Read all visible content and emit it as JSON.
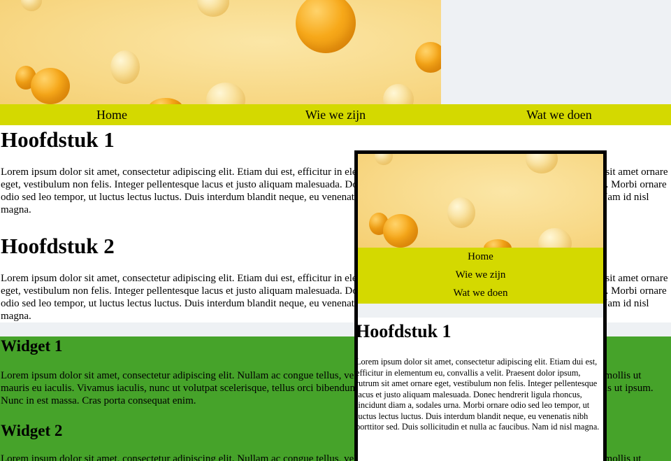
{
  "nav": {
    "items": [
      "Home",
      "Wie we zijn",
      "Wat we doen"
    ]
  },
  "main": {
    "sections": [
      {
        "title": "Hoofdstuk 1",
        "text": "Lorem ipsum dolor sit amet, consectetur adipiscing elit. Etiam dui est, efficitur in elementum eu, convallis a velit. Praesent dolor ipsum, rutrum sit amet ornare eget, vestibulum non felis. Integer pellentesque lacus et justo aliquam malesuada. Donec hendrerit ligula rhoncus, tincidunt diam a, sodales urna. Morbi ornare odio sed leo tempor, ut luctus lectus luctus. Duis interdum blandit neque, eu venenatis nibh porttitor sed. Duis sollicitudin et nulla ac faucibus. Nam id nisl magna."
      },
      {
        "title": "Hoofdstuk 2",
        "text": "Lorem ipsum dolor sit amet, consectetur adipiscing elit. Etiam dui est, efficitur in elementum eu, convallis a velit. Praesent dolor ipsum, rutrum sit amet ornare eget, vestibulum non felis. Integer pellentesque lacus et justo aliquam malesuada. Donec hendrerit ligula rhoncus, tincidunt diam a, sodales urna. Morbi ornare odio sed leo tempor, ut luctus lectus luctus. Duis interdum blandit neque, eu venenatis nibh porttitor sed. Duis sollicitudin et nulla ac faucibus. Nam id nisl magna."
      }
    ]
  },
  "widgets": [
    {
      "title": "Widget 1",
      "text": "Lorem ipsum dolor sit amet, consectetur adipiscing elit. Nullam ac congue tellus, vel condimentum enim. Aenean non nisi vitae lorem euismod mollis ut mauris eu iaculis. Vivamus iaculis, nunc ut volutpat scelerisque, tellus orci bibendum erat, a pellentesque velit dolor sit amet lorem. Etiam ut felis ut ipsum. Nunc in est massa. Cras porta consequat enim."
    },
    {
      "title": "Widget 2",
      "text": "Lorem ipsum dolor sit amet, consectetur adipiscing elit. Nullam ac congue tellus, vel condimentum enim. Aenean non nisi vitae lorem euismod mollis ut mauris eu"
    }
  ],
  "phone_preview": {
    "nav_items": [
      "Home",
      "Wie we zijn",
      "Wat we doen"
    ],
    "title": "Hoofdstuk 1",
    "text": "Lorem ipsum dolor sit amet, consectetur adipiscing elit. Etiam dui est, efficitur in elementum eu, convallis a velit. Praesent dolor ipsum, rutrum sit amet ornare eget, vestibulum non felis. Integer pellentesque lacus et justo aliquam malesuada. Donec hendrerit ligula rhoncus, tincidunt diam a, sodales urna. Morbi ornare odio sed leo tempor, ut luctus lectus luctus. Duis interdum blandit neque, eu venenatis nibh porttitor sed. Duis sollicitudin et nulla ac faucibus. Nam id nisl magna."
  },
  "colors": {
    "nav_bg": "#d4d900",
    "widget_bg": "#46a32a",
    "page_bg": "#eef1f4",
    "hero_bg": "#f8d988",
    "phone_border": "#000000"
  }
}
